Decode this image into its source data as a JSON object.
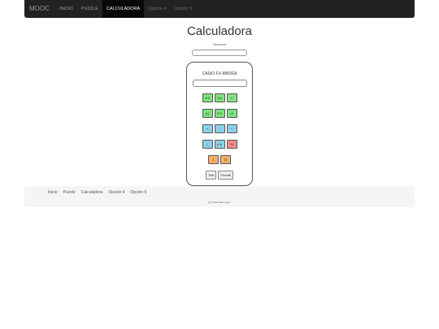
{
  "navbar": {
    "brand": "MOOC",
    "links": [
      {
        "label": "INICIO"
      },
      {
        "label": "PUZZLE"
      },
      {
        "label": "CALCULADORA"
      },
      {
        "label": "Opción 4"
      },
      {
        "label": "Opción 5"
      }
    ],
    "active": "CALCULADORA"
  },
  "main": {
    "title": "Calculadora",
    "memory_label": "Memoria",
    "memory_value": ""
  },
  "calculator": {
    "model": "CASIO FX-9860GII",
    "display_value": "",
    "rows": [
      [
        "x^2",
        "1/x",
        "√"
      ],
      [
        "|x|",
        "2^n",
        "n!"
      ],
      [
        "+",
        "-",
        "*"
      ],
      [
        "/",
        "x^y",
        "%"
      ],
      [
        "Σ",
        "∏"
      ],
      [
        "ToM",
        "FromM"
      ]
    ]
  },
  "footer": {
    "links": [
      "Inicio",
      "Puzzle",
      "Calculadora",
      "Opción 4",
      "Opción 5"
    ],
    "copyright": "(C) 2016 Raúl López"
  },
  "colors": {
    "navbar": "#222222",
    "green_key": "#7fe27f",
    "blue_key": "#8ed0ea",
    "red_key": "#f38a8a",
    "orange_key": "#f5b06b"
  }
}
